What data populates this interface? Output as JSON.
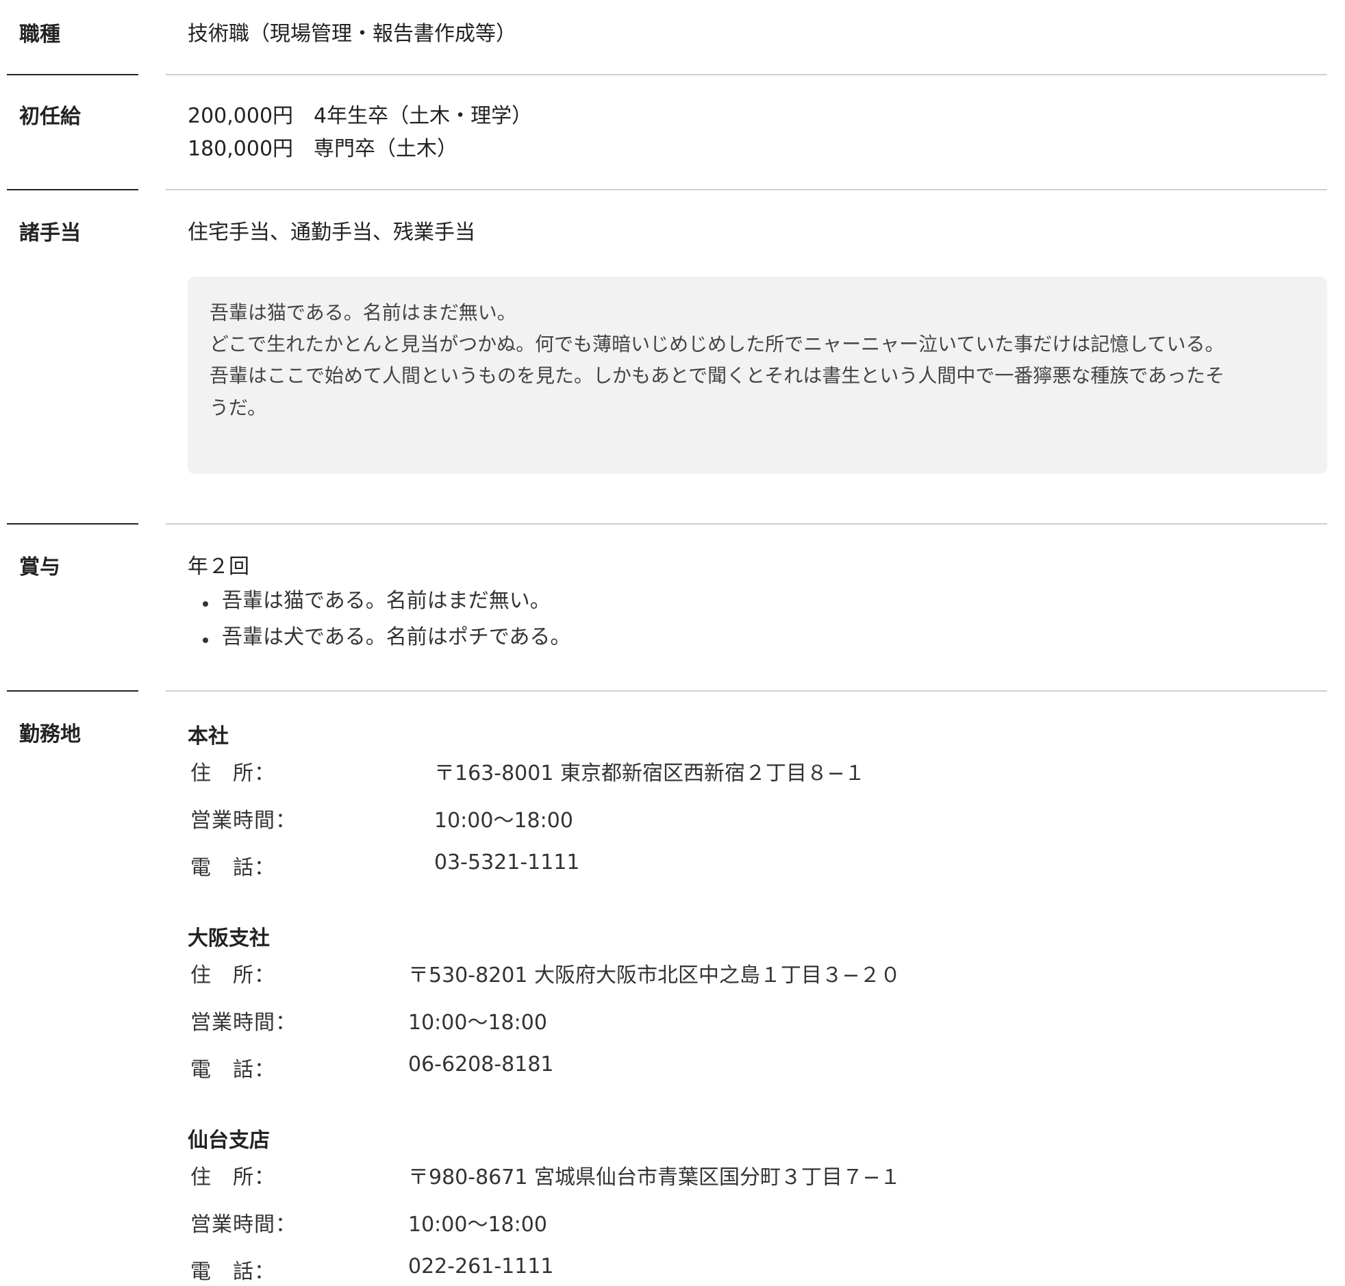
{
  "sections": {
    "job_type": {
      "label": "職種",
      "value": "技術職（現場管理・報告書作成等）"
    },
    "starting_salary": {
      "label": "初任給",
      "lines": [
        "200,000円　4年生卒（土木・理学）",
        "180,000円　専門卒（土木）"
      ]
    },
    "allowances": {
      "label": "諸手当",
      "value": "住宅手当、通勤手当、残業手当",
      "note": [
        "吾輩は猫である。名前はまだ無い。",
        "どこで生れたかとんと見当がつかぬ。何でも薄暗いじめじめした所でニャーニャー泣いていた事だけは記憶している。",
        "吾輩はここで始めて人間というものを見た。しかもあとで聞くとそれは書生という人間中で一番獰悪な種族であったそ",
        "うだ。"
      ]
    },
    "bonus": {
      "label": "賞与",
      "value": "年２回",
      "items": [
        "吾輩は猫である。名前はまだ無い。",
        "吾輩は犬である。名前はポチである。"
      ]
    },
    "location": {
      "label": "勤務地",
      "offices": [
        {
          "name": "本社",
          "address_key": "住　所：",
          "address": "〒163-8001 東京都新宿区西新宿２丁目８−１",
          "hours_key": "営業時間：",
          "hours": "10:00〜18:00",
          "phone_key": "電　話：",
          "phone": "03-5321-1111"
        },
        {
          "name": "大阪支社",
          "address_key": "住　所：",
          "address": "〒530-8201 大阪府大阪市北区中之島１丁目３−２０",
          "hours_key": "営業時間：",
          "hours": "10:00〜18:00",
          "phone_key": "電　話：",
          "phone": "06-6208-8181"
        },
        {
          "name": "仙台支店",
          "address_key": "住　所：",
          "address": "〒980-8671 宮城県仙台市青葉区国分町３丁目７−１",
          "hours_key": "営業時間：",
          "hours": "10:00〜18:00",
          "phone_key": "電　話：",
          "phone": "022-261-1111"
        }
      ]
    }
  }
}
